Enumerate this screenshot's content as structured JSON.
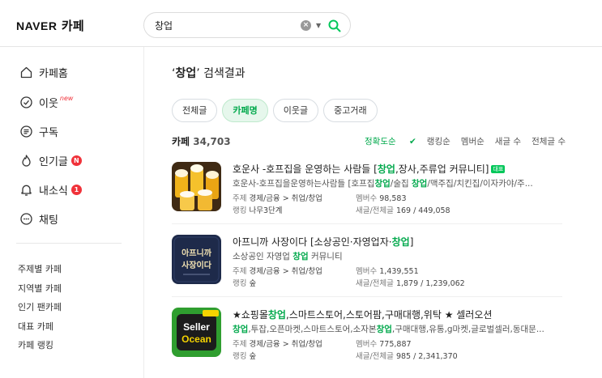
{
  "header": {
    "logo_brand": "NAVER",
    "logo_service": "카페",
    "search_value": "창업"
  },
  "sidebar": {
    "items": [
      {
        "label": "카페홈",
        "icon": "home-icon"
      },
      {
        "label": "이웃",
        "icon": "check-badge-icon",
        "new": "new"
      },
      {
        "label": "구독",
        "icon": "list-icon"
      },
      {
        "label": "인기글",
        "icon": "flame-icon",
        "badge": "N"
      },
      {
        "label": "내소식",
        "icon": "bell-icon",
        "badge": "1"
      },
      {
        "label": "채팅",
        "icon": "chat-icon"
      }
    ],
    "sub_items": [
      "주제별 카페",
      "지역별 카페",
      "인기 팬카페",
      "대표 카페",
      "카페 랭킹"
    ]
  },
  "main": {
    "title_keyword": "창업",
    "title_suffix": " 검색결과",
    "tabs": [
      "전체글",
      "카페명",
      "이웃글",
      "중고거래"
    ],
    "active_tab": "카페명",
    "count_label": "카페",
    "count_value": "34,703",
    "sorts": [
      "정확도순",
      "랭킹순",
      "멤버순",
      "새글 수",
      "전체글 수"
    ],
    "results": [
      {
        "name_pre": "호운사 -호프집을 운영하는 사람들 [",
        "name_hl": "창업",
        "name_post": ",장사,주류업 커뮤니티]",
        "name_tag": "대표",
        "desc_a": "호운사-호프집을운영하는사람들 [호프집",
        "desc_hl1": "창업",
        "desc_b": "/술집 ",
        "desc_hl2": "창업",
        "desc_c": "/맥주집/치킨집/이자카야/주...",
        "topic_label": "주제",
        "topic": "경제/금융 > 취업/창업",
        "rank_label": "랭킹",
        "rank": "나무3단계",
        "members_label": "멤버수",
        "members": "98,583",
        "posts_label": "새글/전체글",
        "posts": "169 / 449,058"
      },
      {
        "name_pre": "아프니까 사장이다 [소상공인·자영업자·",
        "name_hl": "창업",
        "name_post": "]",
        "desc_a": "소상공인 자영업 ",
        "desc_hl1": "창업",
        "desc_b": " 커뮤니티",
        "topic_label": "주제",
        "topic": "경제/금융 > 취업/창업",
        "rank_label": "랭킹",
        "rank": "숲",
        "members_label": "멤버수",
        "members": "1,439,551",
        "posts_label": "새글/전체글",
        "posts": "1,879 / 1,239,062",
        "thumb_text": "아프니까 사장이다"
      },
      {
        "name_pre": "★쇼핑몰",
        "name_hl": "창업",
        "name_post": ",스마트스토어,스토어팜,구매대행,위탁 ★ 셀러오션",
        "desc_hl1": "창업",
        "desc_a": ",투잡,오픈마켓,스마트스토어,소자본",
        "desc_hl2": "창업",
        "desc_c": ",구매대행,유통,g마켓,글로벌셀러,동대문...",
        "topic_label": "주제",
        "topic": "경제/금융 > 취업/창업",
        "rank_label": "랭킹",
        "rank": "숲",
        "members_label": "멤버수",
        "members": "775,887",
        "posts_label": "새글/전체글",
        "posts": "985 / 2,341,370",
        "thumb_text_1": "Seller",
        "thumb_text_2": "Ocean"
      }
    ]
  },
  "colors": {
    "accent": "#03a94d",
    "badge": "#f0323a",
    "tab_active_bg": "#e6f7ec"
  }
}
